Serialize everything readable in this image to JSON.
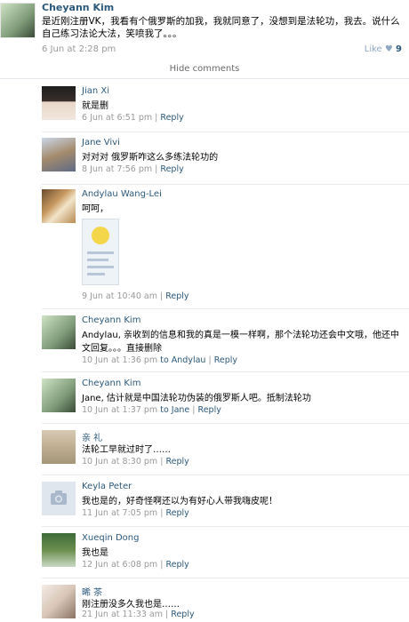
{
  "post": {
    "author": "Cheyann Kim",
    "text": "是近刚注册VK，我看有个俄罗斯的加我，我就同意了，没想到是法轮功，我去。说什么自己练习法论大法，笑喷我了。。。",
    "date": "6 Jun at 2:28 pm",
    "like_label": "Like",
    "like_count": "9"
  },
  "hide_comments": "Hide comments",
  "comments": [
    {
      "author": "Jian Xi",
      "text": "就是删",
      "date": "6 Jun at 6:51 pm",
      "to": "",
      "reply": "Reply"
    },
    {
      "author": "Jane Vivi",
      "text": "对对对 俄罗斯咋这么多练法轮功的",
      "date": "8 Jun at 7:56 pm",
      "to": "",
      "reply": "Reply"
    },
    {
      "author": "Andylau Wang-Lei",
      "text": "呵呵，",
      "date": "9 Jun at 10:40 am",
      "to": "",
      "reply": "Reply"
    },
    {
      "author": "Cheyann Kim",
      "text": "Andylau, 亲收到的信息和我的真是一模一样啊，那个法轮功还会中文哦，他还中文回复。。。直接删除",
      "date": "10 Jun at 1:36 pm",
      "to": "to Andylau",
      "reply": "Reply"
    },
    {
      "author": "Cheyann Kim",
      "text": "Jane, 估计就是中国法轮功伪装的俄罗斯人吧。抵制法轮功",
      "date": "10 Jun at 1:37 pm",
      "to": "to Jane",
      "reply": "Reply"
    },
    {
      "author": "亲 礼",
      "text": "法轮工早就过时了……",
      "date": "10 Jun at 8:30 pm",
      "to": "",
      "reply": "Reply"
    },
    {
      "author": "Keyla Peter",
      "text": "我也是的，好奇怪啊还以为有好心人带我嗨皮呢！",
      "date": "11 Jun at 7:05 pm",
      "to": "",
      "reply": "Reply"
    },
    {
      "author": "Xueqin Dong",
      "text": "我也是",
      "date": "12 Jun at 6:08 pm",
      "to": "",
      "reply": "Reply"
    },
    {
      "author": "晞 茶",
      "text": "刚注册没多久我也是……",
      "date": "21 Jun at 11:33 am",
      "to": "",
      "reply": "Reply"
    }
  ]
}
